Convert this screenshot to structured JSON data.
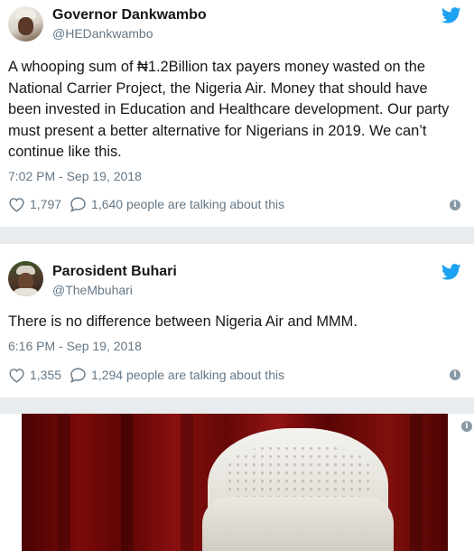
{
  "tweets": [
    {
      "name": "Governor Dankwambo",
      "handle": "@HEDankwambo",
      "text": "A whooping sum of ₦1.2Billion tax payers money wasted on the National Carrier Project, the Nigeria Air. Money that should have been invested in Education and Healthcare development. Our party must present a better alternative for Nigerians in 2019. We can’t continue like this.",
      "time": "7:02 PM - Sep 19, 2018",
      "likes": "1,797",
      "talking": "1,640 people are talking about this"
    },
    {
      "name": "Parosident Buhari",
      "handle": "@TheMbuhari",
      "text": "There is no difference between Nigeria Air and MMM.",
      "time": "6:16 PM - Sep 19, 2018",
      "likes": "1,355",
      "talking": "1,294 people are talking about this"
    }
  ],
  "icons": {
    "brand": "twitter-bird-icon",
    "like": "heart-icon",
    "reply": "speech-bubble-icon",
    "info": "info-icon"
  },
  "colors": {
    "twitter_blue": "#1da1f2",
    "secondary_text": "#657786",
    "primary_text": "#14171a",
    "separator": "#e9ecef"
  },
  "info_glyph": "i"
}
